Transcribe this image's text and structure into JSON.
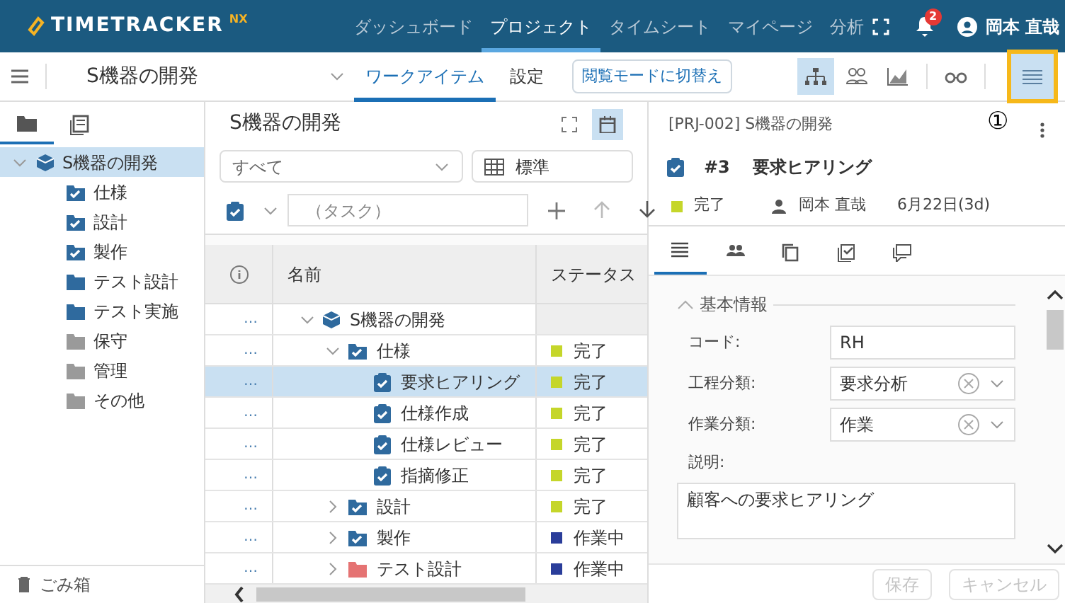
{
  "header": {
    "logo": "TIMETRACKER",
    "logo_suffix": "NX",
    "nav": [
      {
        "label": "ダッシュボード",
        "selected": false
      },
      {
        "label": "プロジェクト",
        "selected": true
      },
      {
        "label": "タイムシート",
        "selected": false
      },
      {
        "label": "マイページ",
        "selected": false
      },
      {
        "label": "分析",
        "selected": false
      }
    ],
    "notification_count": "2",
    "user": "岡本 直哉"
  },
  "toolbar": {
    "project": "S機器の開発",
    "tabs": [
      {
        "label": "ワークアイテム",
        "selected": true
      },
      {
        "label": "設定",
        "selected": false
      }
    ],
    "mode_button": "閲覧モードに切替え",
    "view_buttons": [
      {
        "kind": "hierarchy",
        "selected": true
      },
      {
        "kind": "people",
        "selected": false
      },
      {
        "kind": "chart",
        "selected": false
      },
      {
        "kind": "glasses",
        "selected": false
      },
      {
        "kind": "list",
        "selected": true
      }
    ],
    "annotation": "①"
  },
  "sidebar": {
    "tabs": [
      {
        "kind": "folder",
        "selected": true
      },
      {
        "kind": "list",
        "selected": false
      }
    ],
    "tree": [
      {
        "label": "S機器の開発",
        "kind": "project",
        "expanded": true,
        "selected": true,
        "children": [
          {
            "label": "仕様",
            "kind": "task-group",
            "selected": false
          },
          {
            "label": "設計",
            "kind": "task-group",
            "selected": false
          },
          {
            "label": "製作",
            "kind": "task-group",
            "selected": false
          },
          {
            "label": "テスト設計",
            "kind": "folder",
            "color": "#2f6a9e",
            "selected": false
          },
          {
            "label": "テスト実施",
            "kind": "folder",
            "color": "#2f6a9e",
            "selected": false
          },
          {
            "label": "保守",
            "kind": "folder",
            "color": "#9a9a9a",
            "selected": false
          },
          {
            "label": "管理",
            "kind": "folder",
            "color": "#9a9a9a",
            "selected": false
          },
          {
            "label": "その他",
            "kind": "folder",
            "color": "#9a9a9a",
            "selected": false
          }
        ]
      }
    ],
    "trash": "ごみ箱"
  },
  "list": {
    "title": "S機器の開発",
    "filter": "すべて",
    "view": "標準",
    "task_placeholder": "（タスク）",
    "columns": [
      "名前",
      "ステータス"
    ],
    "rows": [
      {
        "actions": "…",
        "name": "S機器の開発",
        "kind": "project",
        "expanded": true,
        "selected": false,
        "children": [
          {
            "actions": "…",
            "name": "仕様",
            "kind": "task-group",
            "expanded": true,
            "selected": false,
            "status": {
              "text": "完了",
              "color": "#c5d62a"
            },
            "children": [
              {
                "actions": "…",
                "name": "要求ヒアリング",
                "kind": "task",
                "selected": true,
                "status": {
                  "text": "完了",
                  "color": "#c5d62a"
                }
              },
              {
                "actions": "…",
                "name": "仕様作成",
                "kind": "task",
                "selected": false,
                "status": {
                  "text": "完了",
                  "color": "#c5d62a"
                }
              },
              {
                "actions": "…",
                "name": "仕様レビュー",
                "kind": "task",
                "selected": false,
                "status": {
                  "text": "完了",
                  "color": "#c5d62a"
                }
              },
              {
                "actions": "…",
                "name": "指摘修正",
                "kind": "task",
                "selected": false,
                "status": {
                  "text": "完了",
                  "color": "#c5d62a"
                }
              }
            ]
          },
          {
            "actions": "…",
            "name": "設計",
            "kind": "task-group",
            "expanded": false,
            "selected": false,
            "status": {
              "text": "完了",
              "color": "#c5d62a"
            }
          },
          {
            "actions": "…",
            "name": "製作",
            "kind": "task-group",
            "expanded": false,
            "selected": false,
            "status": {
              "text": "作業中",
              "color": "#2a3d9a"
            }
          },
          {
            "actions": "…",
            "name": "テスト設計",
            "kind": "folder",
            "color": "#e57373",
            "expanded": false,
            "selected": false,
            "status": {
              "text": "作業中",
              "color": "#2a3d9a"
            }
          }
        ]
      }
    ]
  },
  "detail": {
    "breadcrumb": "[PRJ-002] S機器の開発",
    "number": "#3",
    "title": "要求ヒアリング",
    "status": {
      "text": "完了",
      "color": "#c5d62a"
    },
    "assignee": "岡本 直哉",
    "date": "6月22日(3d)",
    "tabs": [
      {
        "kind": "lines",
        "selected": true
      },
      {
        "kind": "people",
        "selected": false
      },
      {
        "kind": "copy",
        "selected": false
      },
      {
        "kind": "check",
        "selected": false
      },
      {
        "kind": "comment",
        "selected": false
      }
    ],
    "section": {
      "title": "基本情報",
      "expanded": true
    },
    "fields": [
      {
        "label": "コード:",
        "kind": "text",
        "value": "RH"
      },
      {
        "label": "工程分類:",
        "kind": "select",
        "value": "要求分析"
      },
      {
        "label": "作業分類:",
        "kind": "select",
        "value": "作業"
      }
    ],
    "description_label": "説明:",
    "description": "顧客への要求ヒアリング",
    "buttons": [
      {
        "label": "保存",
        "disabled": true
      },
      {
        "label": "キャンセル",
        "disabled": true
      }
    ]
  }
}
